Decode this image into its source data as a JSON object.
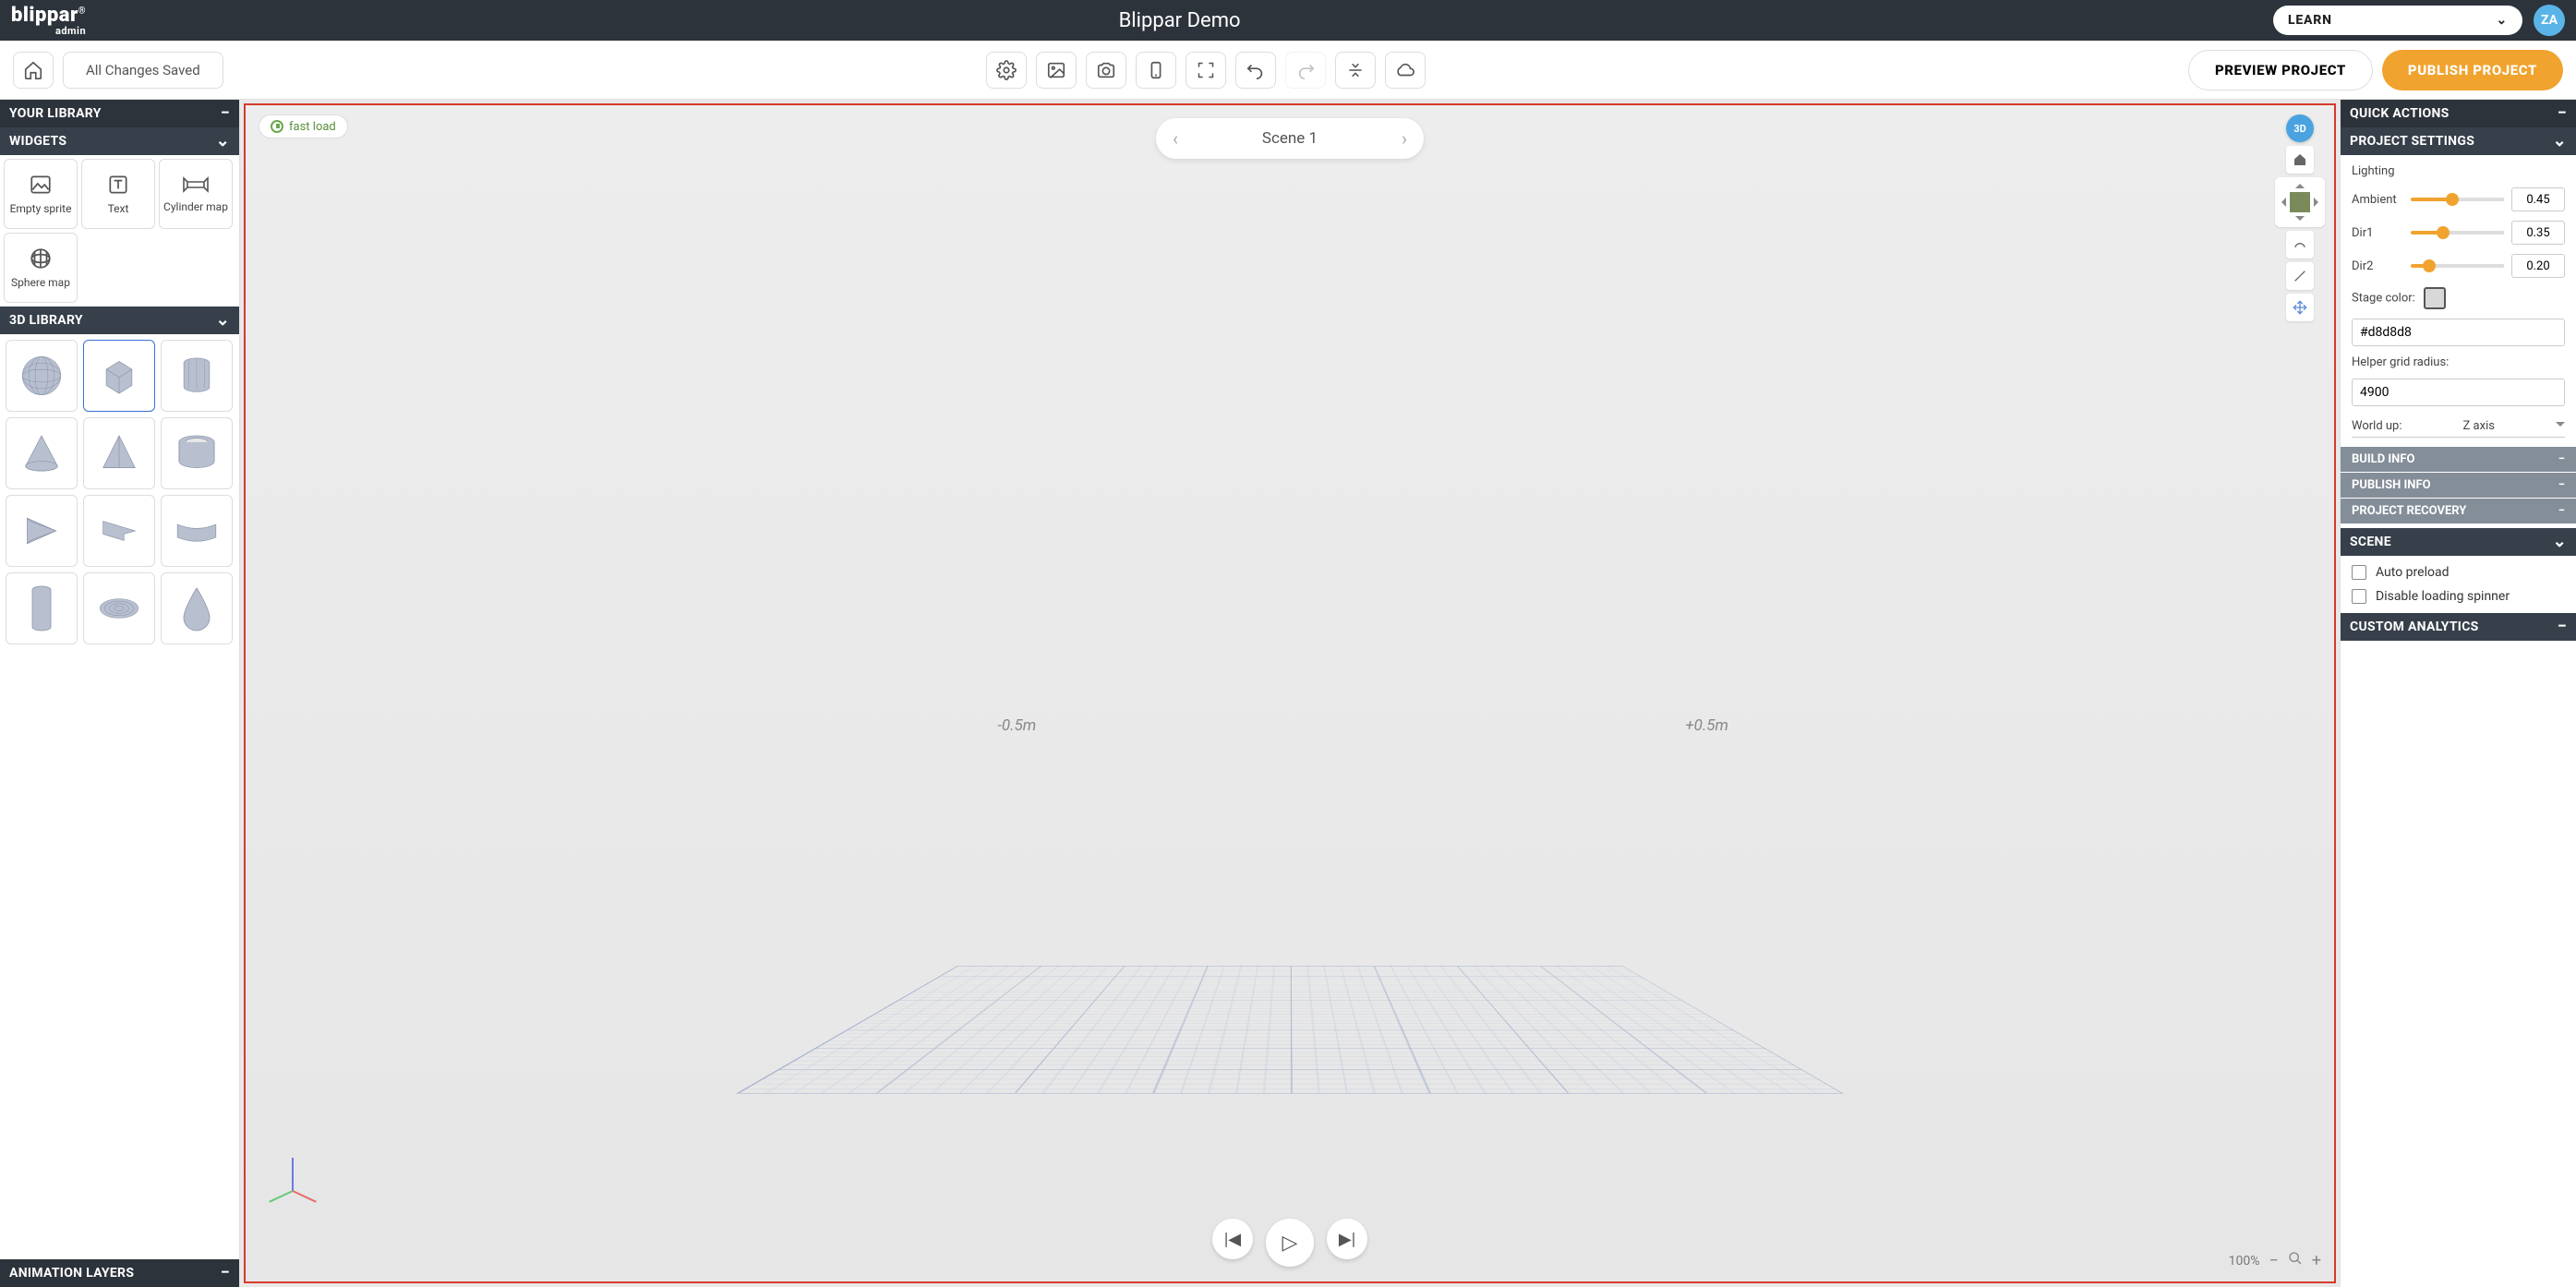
{
  "header": {
    "logo": "blippar",
    "logo_sub": "admin",
    "title": "Blippar Demo",
    "learn": "LEARN",
    "avatar": "ZA"
  },
  "toolbar": {
    "status": "All Changes Saved",
    "preview": "PREVIEW PROJECT",
    "publish": "PUBLISH PROJECT"
  },
  "left": {
    "your_library": "YOUR LIBRARY",
    "widgets_header": "WIDGETS",
    "widgets": {
      "empty_sprite": "Empty sprite",
      "text": "Text",
      "cylinder_map": "Cylinder map",
      "sphere_map": "Sphere map"
    },
    "library_header": "3D LIBRARY",
    "animation_layers": "ANIMATION LAYERS"
  },
  "canvas": {
    "fast_load": "fast load",
    "scene": "Scene 1",
    "dim_left": "-0.5m",
    "dim_right": "+0.5m",
    "zoom": "100%",
    "badge_3d": "3D"
  },
  "right": {
    "quick_actions": "QUICK ACTIONS",
    "project_settings": "PROJECT SETTINGS",
    "lighting": "Lighting",
    "ambient": "Ambient",
    "ambient_val": "0.45",
    "dir1": "Dir1",
    "dir1_val": "0.35",
    "dir2": "Dir2",
    "dir2_val": "0.20",
    "stage_color_label": "Stage color:",
    "stage_color": "#d8d8d8",
    "grid_radius_label": "Helper grid radius:",
    "grid_radius": "4900",
    "world_up_label": "World up:",
    "world_up": "Z axis",
    "build_info": "BUILD INFO",
    "publish_info": "PUBLISH INFO",
    "project_recovery": "PROJECT RECOVERY",
    "scene": "SCENE",
    "auto_preload": "Auto preload",
    "disable_spinner": "Disable loading spinner",
    "custom_analytics": "CUSTOM ANALYTICS"
  }
}
